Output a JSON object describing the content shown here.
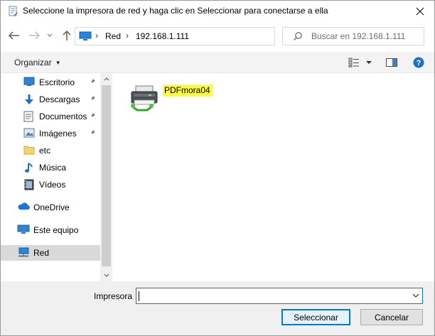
{
  "window": {
    "title": "Seleccione la impresora de red y haga clic en Seleccionar para conectarse a ella"
  },
  "address": {
    "breadcrumb": [
      "Red",
      "192.168.1.111"
    ],
    "search_placeholder": "Buscar en 192.168.1.111"
  },
  "toolbar": {
    "organize_label": "Organizar"
  },
  "sidebar": {
    "quick_access": [
      {
        "label": "Escritorio",
        "icon": "desktop-icon",
        "pinned": true
      },
      {
        "label": "Descargas",
        "icon": "download-icon",
        "pinned": true
      },
      {
        "label": "Documentos",
        "icon": "documents-icon",
        "pinned": true
      },
      {
        "label": "Imágenes",
        "icon": "pictures-icon",
        "pinned": true
      },
      {
        "label": "etc",
        "icon": "folder-icon",
        "pinned": false
      },
      {
        "label": "Música",
        "icon": "music-icon",
        "pinned": false
      },
      {
        "label": "Vídeos",
        "icon": "videos-icon",
        "pinned": false
      }
    ],
    "roots": [
      {
        "label": "OneDrive",
        "icon": "onedrive-icon",
        "selected": false
      },
      {
        "label": "Este equipo",
        "icon": "computer-icon",
        "selected": false
      },
      {
        "label": "Red",
        "icon": "network-icon",
        "selected": true
      }
    ]
  },
  "content": {
    "items": [
      {
        "label": "PDFmora04",
        "icon": "printer-icon",
        "highlight_color": "#fffa3a"
      }
    ]
  },
  "footer": {
    "printer_label": "Impresora",
    "printer_value": "",
    "select_label": "Seleccionar",
    "cancel_label": "Cancelar"
  },
  "colors": {
    "accent": "#0078d7",
    "selected_bg": "#d9d9d9",
    "highlight": "#fffa3a"
  }
}
